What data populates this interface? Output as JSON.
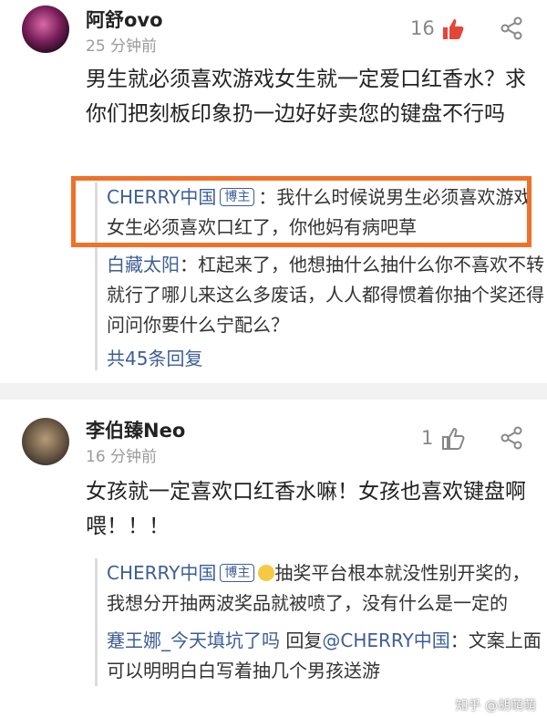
{
  "comments": [
    {
      "username": "阿舒ovo",
      "time": "25 分钟前",
      "likes": "16",
      "text": "男生就必须喜欢游戏女生就一定爱口红香水？求你们把刻板印象扔一边好好卖您的键盘不行吗",
      "replies": [
        {
          "name": "CHERRY中国",
          "badge": "博主",
          "text": "：我什么时候说男生必须喜欢游戏女生必须喜欢口红了，你他妈有病吧草"
        },
        {
          "name": "白藏太阳",
          "text": "：杠起来了，他想抽什么抽什么你不喜欢不转就行了哪儿来这么多废话，人人都得惯着你抽个奖还得问问你要什么宁配么？"
        }
      ],
      "more": "共45条回复"
    },
    {
      "username": "李伯臻Neo",
      "time": "16 分钟前",
      "likes": "1",
      "text": "女孩就一定喜欢口红香水嘛！女孩也喜欢键盘啊喂！！！",
      "replies": [
        {
          "name": "CHERRY中国",
          "badge": "博主",
          "text": "抽奖平台根本就没性别开奖的，我想分开抽两波奖品就被喷了，没有什么是一定的"
        },
        {
          "name": "蹇王娜_今天填坑了吗",
          "reply_word": " 回复",
          "reply_to": "@CHERRY中国",
          "text": "：文案上面可以明明白白写着抽几个男孩送游"
        }
      ]
    }
  ],
  "watermark": "知乎 @胡萌萌"
}
